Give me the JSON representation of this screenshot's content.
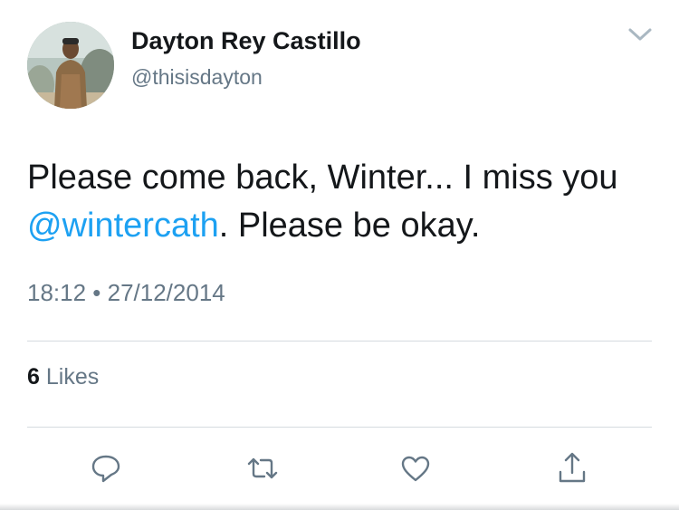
{
  "author": {
    "display_name": "Dayton Rey Castillo",
    "handle": "@thisisdayton"
  },
  "tweet": {
    "text_before": "Please come back, Winter... I miss you ",
    "mention": "@wintercath",
    "text_after": ". Please be okay.",
    "timestamp": "18:12 • 27/12/2014"
  },
  "stats": {
    "likes_count": "6",
    "likes_label": "Likes"
  },
  "icons": {
    "menu": "chevron-down-icon",
    "reply": "reply-icon",
    "retweet": "retweet-icon",
    "like": "heart-icon",
    "share": "share-icon"
  },
  "colors": {
    "text": "#14171a",
    "secondary": "#657786",
    "mention": "#1da1f2",
    "divider": "#d5dbe0"
  }
}
